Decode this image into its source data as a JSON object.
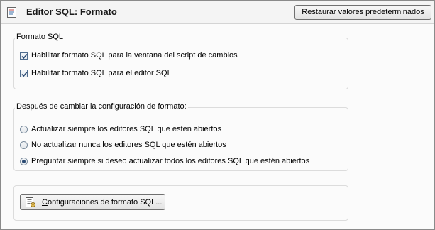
{
  "header": {
    "title": "Editor SQL: Formato",
    "restore_button": "Restaurar valores predeterminados"
  },
  "format_group": {
    "label": "Formato SQL",
    "options": [
      {
        "label": "Habilitar formato SQL para la ventana del script de cambios",
        "checked": true
      },
      {
        "label": "Habilitar formato SQL para el editor SQL",
        "checked": true
      }
    ]
  },
  "after_change_group": {
    "label": "Después de cambiar la configuración de formato:",
    "options": [
      {
        "label": "Actualizar siempre los editores SQL que estén abiertos",
        "selected": false
      },
      {
        "label": "No actualizar nunca los editores SQL que estén abiertos",
        "selected": false
      },
      {
        "label": "Preguntar siempre si deseo actualizar todos los editores SQL que estén abiertos",
        "selected": true
      }
    ]
  },
  "config_button": {
    "mnemonic": "C",
    "rest": "onfiguraciones de formato SQL..."
  },
  "colors": {
    "checkbox_border": "#4f6c8e",
    "check_mark": "#2b4a73",
    "radio_dot": "#2b4a73"
  }
}
